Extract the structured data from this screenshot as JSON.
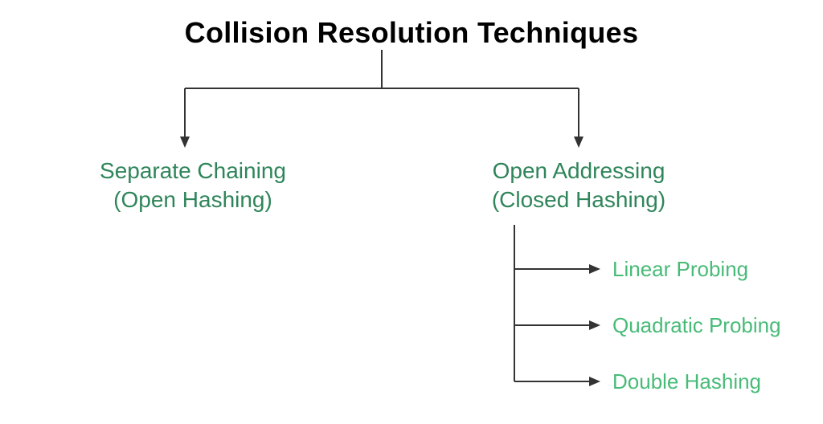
{
  "title": "Collision Resolution Techniques",
  "colors": {
    "dark_green": "#2F855A",
    "light_green": "#48BB78",
    "line": "#333333"
  },
  "branches": {
    "separate_chaining": {
      "line1": "Separate Chaining",
      "line2": "(Open Hashing)"
    },
    "open_addressing": {
      "line1": "Open Addressing",
      "line2": "(Closed Hashing)",
      "children": {
        "linear": "Linear Probing",
        "quadratic": "Quadratic Probing",
        "double": "Double Hashing"
      }
    }
  }
}
